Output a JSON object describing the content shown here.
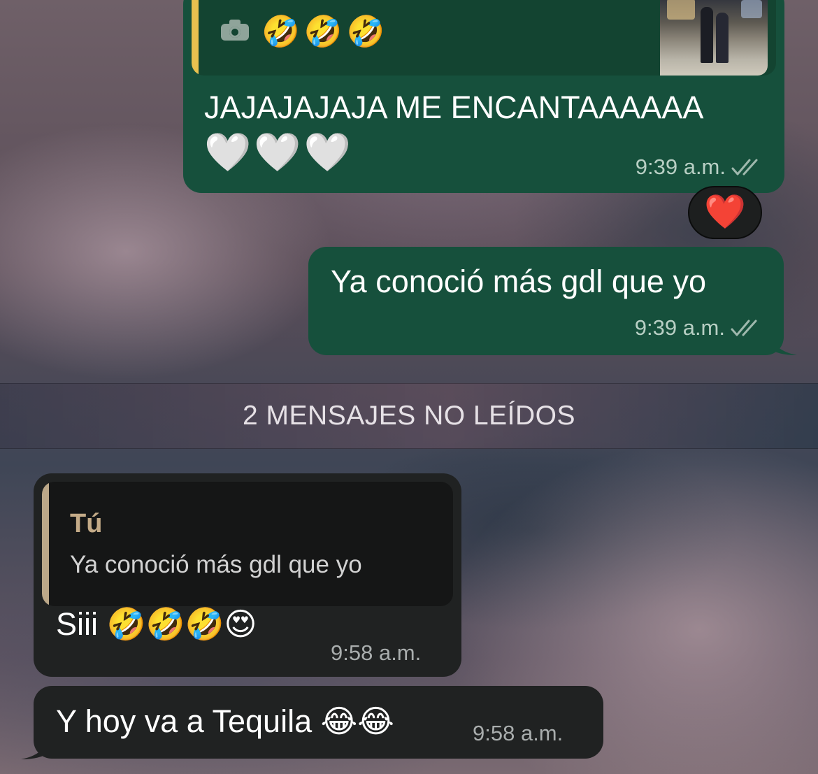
{
  "messages": [
    {
      "direction": "outgoing",
      "quoted_photo_emojis": "🤣🤣🤣",
      "text": "JAJAJAJAJA ME ENCANTAAAAAA",
      "hearts": "🤍🤍🤍",
      "time": "9:39 a.m.",
      "reaction": "❤️"
    },
    {
      "direction": "outgoing",
      "text": "Ya conoció más gdl que yo",
      "time": "9:39 a.m."
    },
    {
      "direction": "incoming",
      "reply_author": "Tú",
      "reply_text": "Ya conoció más gdl que yo",
      "text": "Siii 🤣🤣🤣😍",
      "time": "9:58 a.m."
    },
    {
      "direction": "incoming",
      "text": "Y hoy va a Tequila 😂😂",
      "time": "9:58 a.m."
    }
  ],
  "unread_banner": "2 MENSAJES NO LEÍDOS",
  "icons": {
    "camera": "camera-icon",
    "read_receipt": "double-check-icon",
    "photo_thumbnail": "photo-thumbnail"
  },
  "colors": {
    "outgoing_bubble": "#16503c",
    "incoming_bubble": "#202222",
    "quote_bar_outgoing": "#e8c14f",
    "quote_bar_incoming": "#bca889",
    "reaction_heart": "#e8182b"
  }
}
